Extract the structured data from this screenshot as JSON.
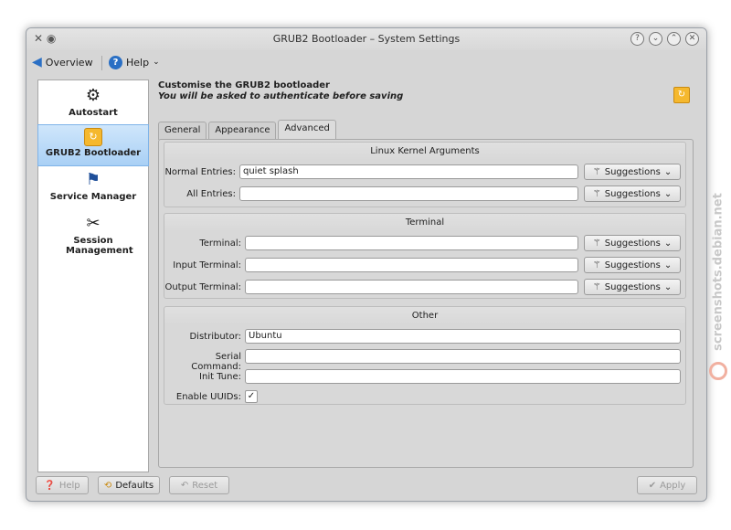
{
  "window": {
    "title": "GRUB2 Bootloader – System Settings"
  },
  "toolbar": {
    "overview": "Overview",
    "help": "Help"
  },
  "sidebar": {
    "items": [
      {
        "label": "Autostart",
        "icon": "gear-icon"
      },
      {
        "label": "GRUB2 Bootloader",
        "icon": "grub-icon",
        "selected": true
      },
      {
        "label": "Service Manager",
        "icon": "flag-icon"
      },
      {
        "label": "Session Management",
        "icon": "tools-icon"
      }
    ]
  },
  "header": {
    "line1": "Customise the GRUB2 bootloader",
    "line2": "You will be asked to authenticate before saving"
  },
  "tabs": [
    {
      "label": "General"
    },
    {
      "label": "Appearance"
    },
    {
      "label": "Advanced",
      "selected": true
    }
  ],
  "kernel": {
    "title": "Linux Kernel Arguments",
    "normal_label": "Normal Entries:",
    "normal_value": "quiet splash",
    "all_label": "All Entries:",
    "all_value": ""
  },
  "terminal": {
    "title": "Terminal",
    "terminal_label": "Terminal:",
    "input_label": "Input Terminal:",
    "output_label": "Output Terminal:"
  },
  "suggestions_label": "Suggestions",
  "other": {
    "title": "Other",
    "distributor_label": "Distributor:",
    "distributor_value": "Ubuntu",
    "serial_label": "Serial Command:",
    "serial_value": "",
    "init_label": "Init Tune:",
    "init_value": "",
    "uuids_label": "Enable UUIDs:",
    "uuids_checked": true
  },
  "buttons": {
    "help": "Help",
    "defaults": "Defaults",
    "reset": "Reset",
    "apply": "Apply"
  },
  "watermark": "screenshots.debian.net"
}
